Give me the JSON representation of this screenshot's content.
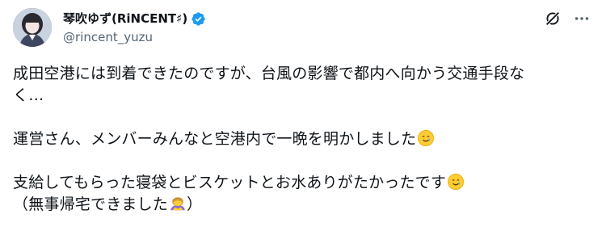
{
  "author": {
    "display_name": "琴吹ゆず(RiNCENT♯)",
    "handle": "@rincent_yuzu"
  },
  "icons": {
    "verified": "verified-badge-icon",
    "grok": "grok-icon",
    "more": "more-icon",
    "emoji_tear": "smiling-face-with-tear-icon",
    "emoji_bow": "person-bowing-icon"
  },
  "colors": {
    "verified_blue": "#1d9bf0",
    "text_primary": "#0f1419",
    "text_secondary": "#536471"
  },
  "tweet": {
    "line1": "成田空港には到着できたのですが、台風の影響で都内へ向かう交通手段な",
    "line2": "く…",
    "line3": "運営さん、メンバーみんなと空港内で一晩を明かしました",
    "line4": "支給してもらった寝袋とビスケットとお水ありがたかったです",
    "line5": "（無事帰宅できました"
  }
}
